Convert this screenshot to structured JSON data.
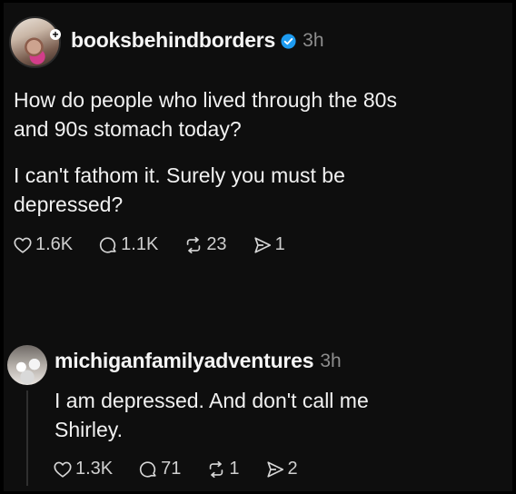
{
  "post": {
    "username": "booksbehindborders",
    "time": "3h",
    "lines_1": [
      "How do people who lived through the 80s",
      "and 90s stomach today?"
    ],
    "lines_2": [
      "I can't fathom it. Surely you must be",
      "depressed?"
    ],
    "likes": "1.6K",
    "comments": "1.1K",
    "reposts": "23",
    "shares": "1"
  },
  "reply": {
    "username": "michiganfamilyadventures",
    "time": "3h",
    "lines": [
      "I am depressed. And don't call me",
      "Shirley."
    ],
    "likes": "1.3K",
    "comments": "71",
    "reposts": "1",
    "shares": "2"
  },
  "colors": {
    "background": "#000000",
    "verified": "#1d9bf0",
    "text": "#f1f1f1",
    "muted": "#8d8d8d"
  }
}
